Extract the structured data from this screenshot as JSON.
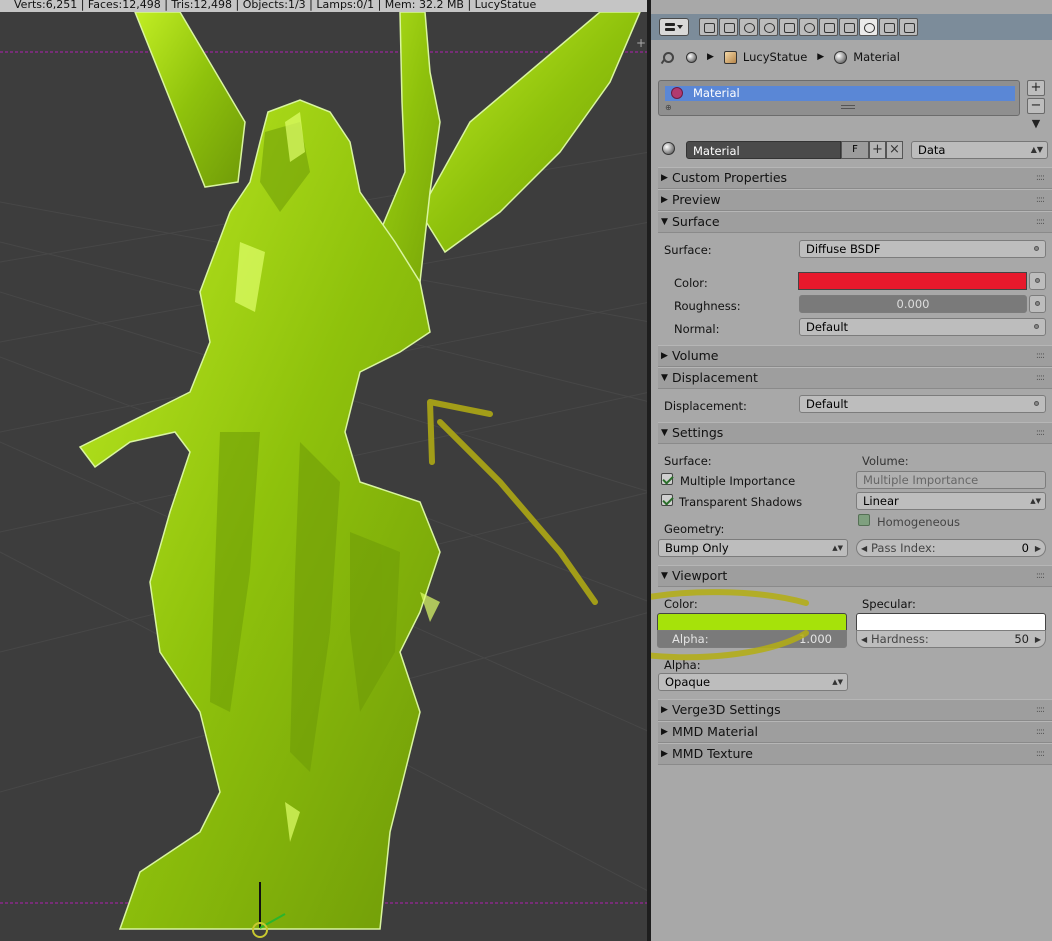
{
  "status_bar": "Verts:6,251 | Faces:12,498 | Tris:12,498 | Objects:1/3 | Lamps:0/1 | Mem: 32.2 MB | LucyStatue",
  "header": {
    "tabs": [
      "render-icon",
      "render-layers-icon",
      "scene-icon",
      "world-icon",
      "object-icon",
      "constraints-icon",
      "modifiers-icon",
      "data-icon",
      "material-icon",
      "texture-icon",
      "particles-icon"
    ],
    "breadcrumb": {
      "object": "LucyStatue",
      "material": "Material"
    }
  },
  "material_slots": {
    "selected": "Material"
  },
  "material_id": {
    "name": "Material",
    "fake_user": "F",
    "link": "Data"
  },
  "panels": {
    "custom_properties": "Custom Properties",
    "preview": "Preview",
    "surface": "Surface",
    "volume": "Volume",
    "displacement": "Displacement",
    "settings": "Settings",
    "viewport": "Viewport",
    "verge3d": "Verge3D Settings",
    "mmd_material": "MMD Material",
    "mmd_texture": "MMD Texture"
  },
  "surface": {
    "surface_label": "Surface:",
    "surface_value": "Diffuse BSDF",
    "color_label": "Color:",
    "color_hex": "#e8192c",
    "roughness_label": "Roughness:",
    "roughness_value": "0.000",
    "normal_label": "Normal:",
    "normal_value": "Default"
  },
  "displacement": {
    "label": "Displacement:",
    "value": "Default"
  },
  "settings": {
    "surface_label": "Surface:",
    "multiple_importance": "Multiple Importance",
    "multiple_importance_checked": true,
    "transparent_shadows": "Transparent Shadows",
    "transparent_shadows_checked": true,
    "geometry_label": "Geometry:",
    "geometry_value": "Bump Only",
    "volume_label": "Volume:",
    "volume_multiple_importance": "Multiple Importance",
    "volume_interpolation": "Linear",
    "homogeneous": "Homogeneous",
    "homogeneous_checked": false,
    "pass_index_label": "Pass Index:",
    "pass_index_value": "0"
  },
  "viewport": {
    "color_label": "Color:",
    "color_hex": "#a6e20a",
    "alpha_label": "Alpha:",
    "alpha_value": "1.000",
    "specular_label": "Specular:",
    "specular_hex": "#ffffff",
    "hardness_label": "Hardness:",
    "hardness_value": "50",
    "blend_label": "Alpha:",
    "blend_value": "Opaque"
  },
  "colors": {
    "mesh": "#9fd10e",
    "annotation": "#b4ae12",
    "grid": "#474747",
    "viewport_bg": "#3d3d3d",
    "selection_slot": "#5a87d6"
  }
}
